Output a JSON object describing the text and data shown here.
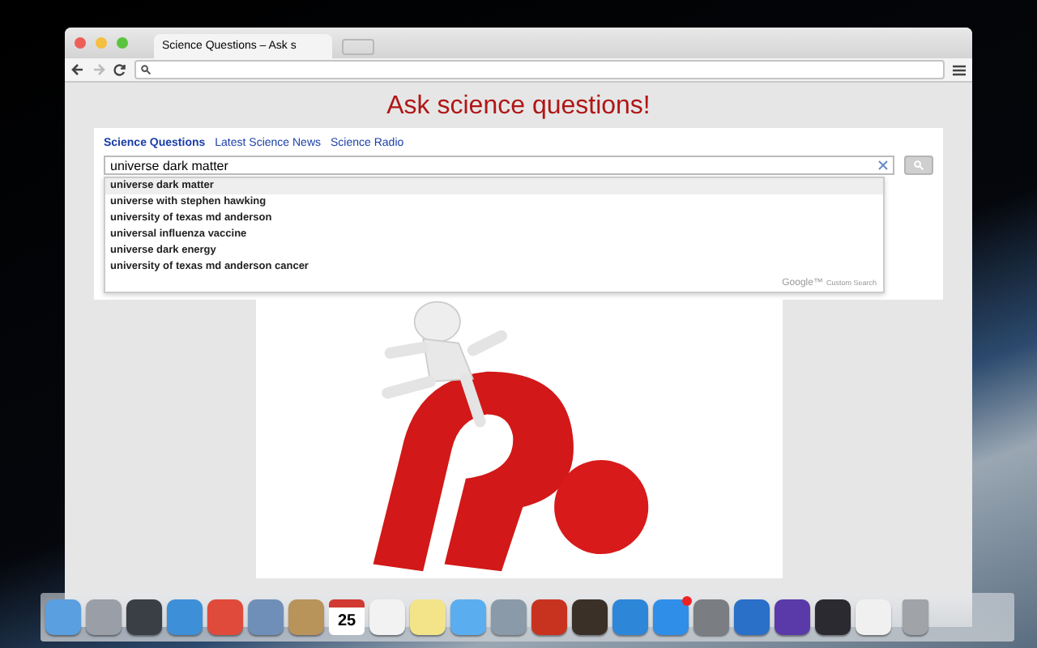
{
  "browser": {
    "tab": {
      "title": "Science Questions – Ask s"
    }
  },
  "page": {
    "heading": "Ask science questions!",
    "tabs": [
      {
        "label": "Science Questions",
        "selected": true
      },
      {
        "label": "Latest Science News",
        "selected": false
      },
      {
        "label": "Science Radio",
        "selected": false
      }
    ],
    "search": {
      "value": "universe dark matter"
    },
    "suggestions": [
      {
        "label": "universe dark matter",
        "selected": true
      },
      {
        "label": "universe with stephen hawking",
        "selected": false
      },
      {
        "label": "university of texas md anderson",
        "selected": false
      },
      {
        "label": "universal influenza vaccine",
        "selected": false
      },
      {
        "label": "universe dark energy",
        "selected": false
      },
      {
        "label": "university of texas md anderson cancer",
        "selected": false
      }
    ],
    "branding": {
      "logo": "Google™",
      "caption": "Custom Search"
    }
  },
  "dock": {
    "items": [
      {
        "kind": "app",
        "color": "#5a9fe0"
      },
      {
        "kind": "app",
        "color": "#9a9ea6"
      },
      {
        "kind": "app",
        "color": "#3a3f46"
      },
      {
        "kind": "app",
        "color": "#3d8fd8"
      },
      {
        "kind": "app",
        "color": "#e04a3a"
      },
      {
        "kind": "app",
        "color": "#6f8fb8"
      },
      {
        "kind": "app",
        "color": "#b8935a"
      },
      {
        "kind": "calendar",
        "day": "25"
      },
      {
        "kind": "app",
        "color": "#f2f2f2"
      },
      {
        "kind": "app",
        "color": "#f3e48a"
      },
      {
        "kind": "app",
        "color": "#5aaef0"
      },
      {
        "kind": "app",
        "color": "#8a9aa8"
      },
      {
        "kind": "app",
        "color": "#c8331f"
      },
      {
        "kind": "app",
        "color": "#3a3028"
      },
      {
        "kind": "app",
        "color": "#2d86d8"
      },
      {
        "kind": "app",
        "color": "#2f8ee8",
        "badge": true
      },
      {
        "kind": "app",
        "color": "#7a7d82"
      },
      {
        "kind": "app",
        "color": "#2a6fc8"
      },
      {
        "kind": "app",
        "color": "#5a3aa8"
      },
      {
        "kind": "app",
        "color": "#2a2a30"
      },
      {
        "kind": "app",
        "color": "#f0f0f0"
      },
      {
        "kind": "trash",
        "color": "#a0a4a8"
      }
    ]
  }
}
